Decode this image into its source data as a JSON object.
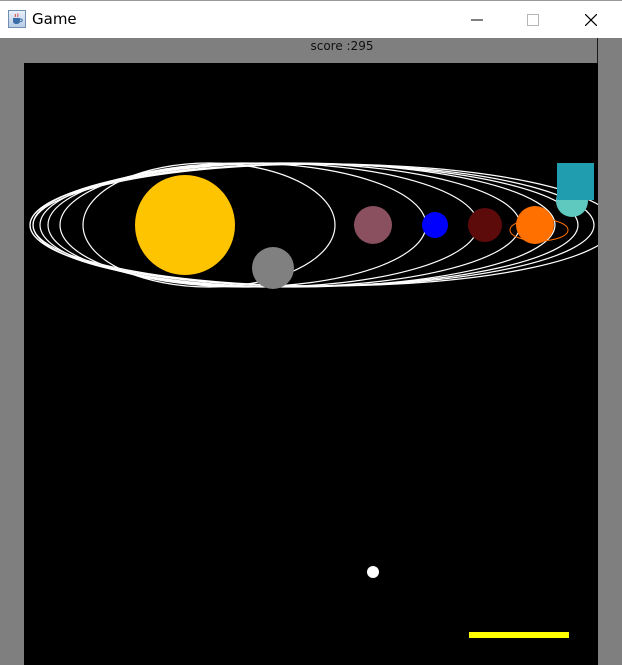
{
  "window": {
    "title": "Game",
    "app_icon": "java-cup-icon",
    "controls": [
      "minimize-icon",
      "maximize-icon",
      "close-icon"
    ]
  },
  "hud": {
    "score_label": "score :295"
  },
  "colors": {
    "window_frame": "#7f7f7f",
    "game_background": "#000000",
    "orbit": "#ffffff",
    "sun": "#ffc400",
    "planet_gray": "#808080",
    "planet_mauve": "#8b5060",
    "planet_blue": "#0000ff",
    "planet_dark_red": "#5c0a0a",
    "planet_orange": "#ff7000",
    "planet_teal": "#5fc9c0",
    "target_block": "#209dae",
    "ball": "#ffffff",
    "paddle": "#ffff00"
  },
  "game": {
    "objects": [
      "sun",
      "orbits",
      "gray-planet",
      "mauve-planet",
      "blue-planet",
      "dark-red-planet",
      "orange-planet",
      "saturn-ring",
      "teal-planet",
      "target-block",
      "ball",
      "paddle"
    ]
  }
}
